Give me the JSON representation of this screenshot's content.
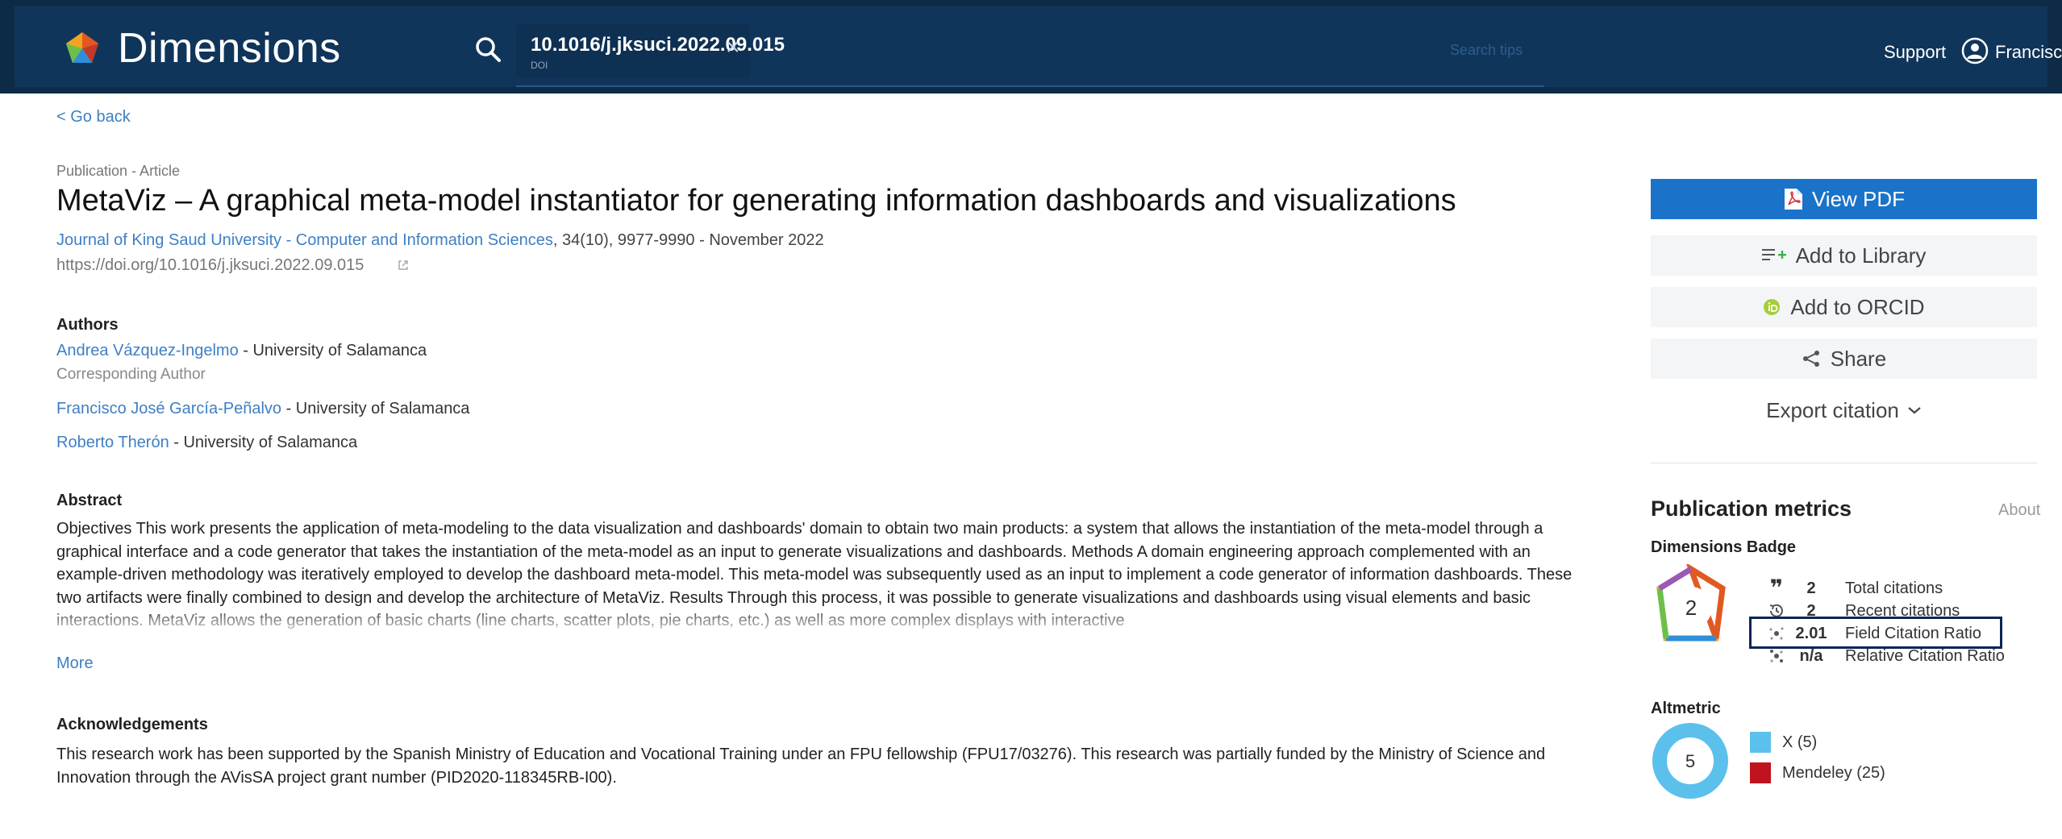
{
  "header": {
    "brand": "Dimensions",
    "search_value": "10.1016/j.jksuci.2022.09.015",
    "search_type": "DOI",
    "search_hint": "Search tips",
    "support_label": "Support",
    "user_name": "Francisc..."
  },
  "nav": {
    "go_back": "< Go back"
  },
  "publication": {
    "type": "Publication - Article",
    "title": "MetaViz – A graphical meta-model instantiator for generating information dashboards and visualizations",
    "journal": "Journal of King Saud University - Computer and Information Sciences",
    "citation_details": ", 34(10), 9977-9990 - November 2022",
    "doi_url": "https://doi.org/10.1016/j.jksuci.2022.09.015"
  },
  "authors": {
    "heading": "Authors",
    "list": [
      {
        "name": "Andrea Vázquez-Ingelmo",
        "affiliation": " - University of Salamanca",
        "role": "Corresponding Author"
      },
      {
        "name": "Francisco José García-Peñalvo",
        "affiliation": " - University of Salamanca"
      },
      {
        "name": "Roberto Therón",
        "affiliation": " - University of Salamanca"
      }
    ]
  },
  "abstract": {
    "heading": "Abstract",
    "text": "Objectives This work presents the application of meta-modeling to the data visualization and dashboards' domain to obtain two main products: a system that allows the instantiation of the meta-model through a graphical interface and a code generator that takes the instantiation of the meta-model as an input to generate visualizations and dashboards. Methods A domain engineering approach complemented with an example-driven methodology was iteratively employed to develop the dashboard meta-model. This meta-model was subsequently used as an input to implement a code generator of information dashboards. These two artifacts were finally combined to design and develop the architecture of MetaViz. Results Through this process, it was possible to generate visualizations and dashboards using visual elements and basic interactions. MetaViz allows the generation of basic charts (line charts, scatter plots, pie charts, etc.) as well as more complex displays with interactive",
    "more_label": "More"
  },
  "acknowledgements": {
    "heading": "Acknowledgements",
    "text": "This research work has been supported by the Spanish Ministry of Education and Vocational Training under an FPU fellowship (FPU17/03276). This research was partially funded by the Ministry of Science and Innovation through the AVisSA project grant number (PID2020-118345RB-I00)."
  },
  "actions": {
    "view_pdf": "View PDF",
    "add_to_library": "Add to Library",
    "add_to_orcid": "Add to ORCID",
    "share": "Share",
    "export_citation": "Export citation"
  },
  "metrics": {
    "heading": "Publication metrics",
    "about_label": "About",
    "badge_heading": "Dimensions Badge",
    "badge_value": "2",
    "rows": [
      {
        "value": "2",
        "label": "Total citations"
      },
      {
        "value": "2",
        "label": "Recent citations"
      },
      {
        "value": "2.01",
        "label": "Field Citation Ratio"
      },
      {
        "value": "n/a",
        "label": "Relative Citation Ratio"
      }
    ],
    "altmetric_heading": "Altmetric",
    "altmetric_score": "5",
    "altmetric_sources": [
      {
        "label": "X (5)",
        "color": "#5bc0eb"
      },
      {
        "label": "Mendeley (25)",
        "color": "#c1121f"
      }
    ]
  },
  "colors": {
    "nav_bg": "#10355a",
    "link": "#3f7fc4",
    "primary_button": "#1a73c9",
    "highlight_border": "#0b2554"
  }
}
